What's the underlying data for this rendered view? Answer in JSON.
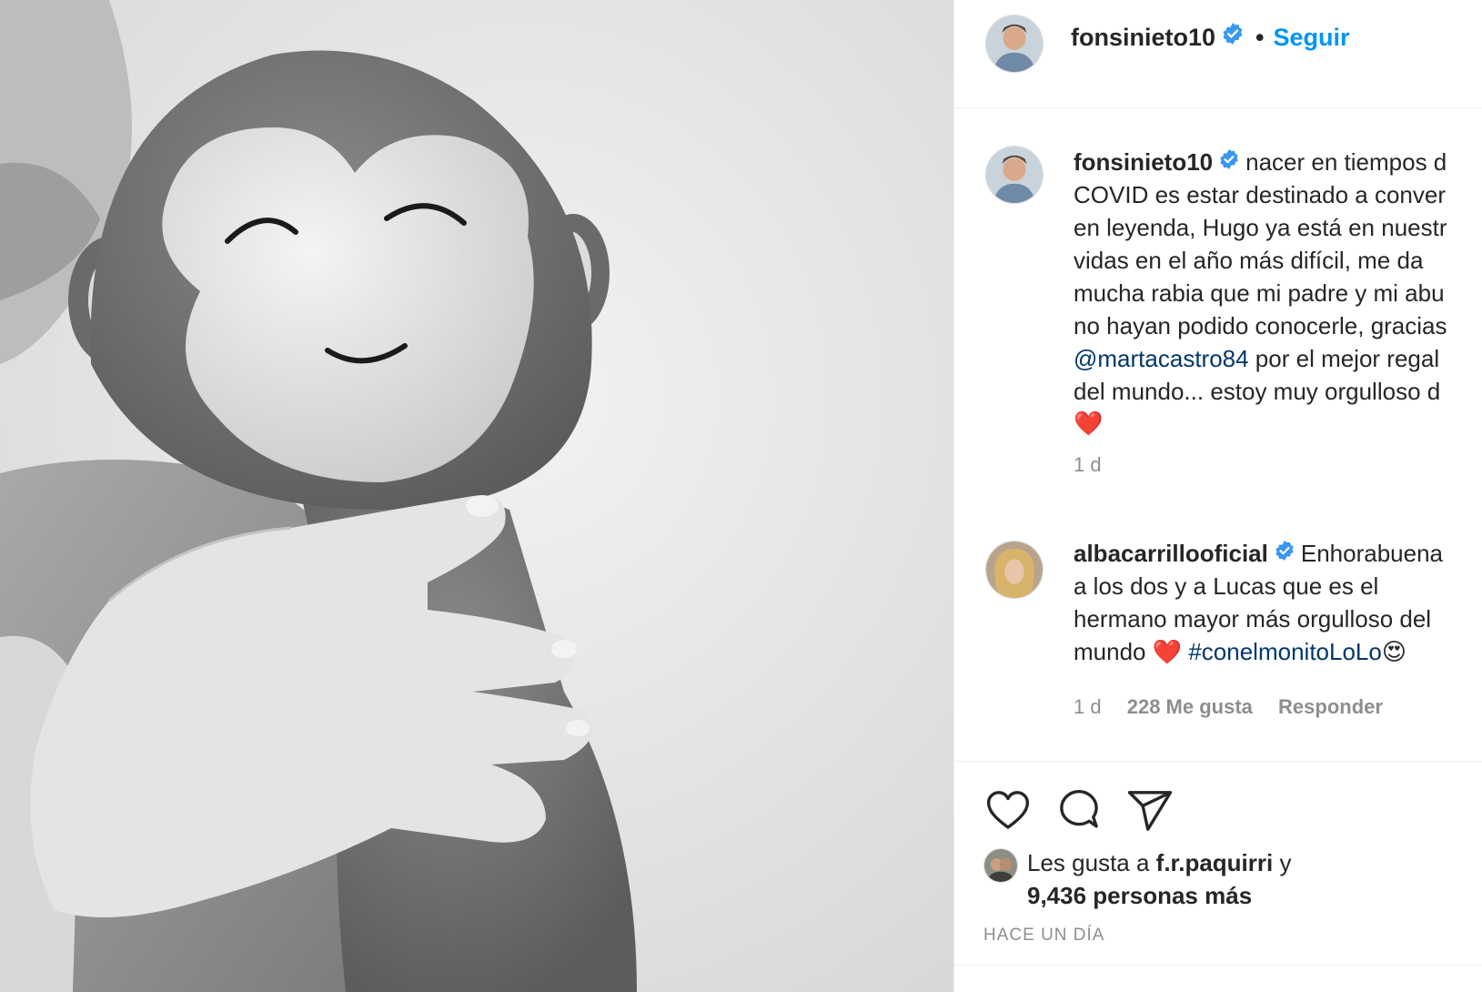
{
  "colors": {
    "link": "#0095f6",
    "mention": "#00376b",
    "muted": "#8e8e8e",
    "heart": "#ed4956",
    "verified": "#3897f0"
  },
  "photo": {
    "subject": "monkey-plush-with-baby-hand"
  },
  "header": {
    "username": "fonsinieto10",
    "separator": "•",
    "follow_label": "Seguir"
  },
  "caption": {
    "username": "fonsinieto10",
    "lines": [
      "nacer en tiempos d",
      "COVID es estar destinado a conver",
      "en leyenda, Hugo ya está en nuestr",
      "vidas en el año más difícil, me da",
      "mucha rabia que mi padre y mi abu",
      "no hayan podido conocerle, gracias"
    ],
    "mention": "@martacastro84",
    "after_mention": " por el mejor regal",
    "line8": "del mundo... estoy muy orgulloso d",
    "emoji": "❤️",
    "time": "1 d"
  },
  "comment": {
    "username": "albacarrillooficial",
    "first_line": "Enhorabuena",
    "lines": [
      "a los dos y a Lucas que es el",
      "hermano mayor más orgulloso del"
    ],
    "last_line_text": "mundo ",
    "heart": "❤️",
    "hashtag": "#conelmonitoLoLo",
    "trailing_emoji": "😍",
    "time": "1 d",
    "likes": "228 Me gusta",
    "reply": "Responder"
  },
  "actions": {
    "like_icon": "heart-icon",
    "comment_icon": "comment-icon",
    "share_icon": "paper-plane-icon"
  },
  "likes": {
    "prefix": "Les gusta a ",
    "user": "f.r.paquirri",
    "suffix": " y",
    "count": "9,436 personas más"
  },
  "time_ago": "HACE UN DÍA"
}
